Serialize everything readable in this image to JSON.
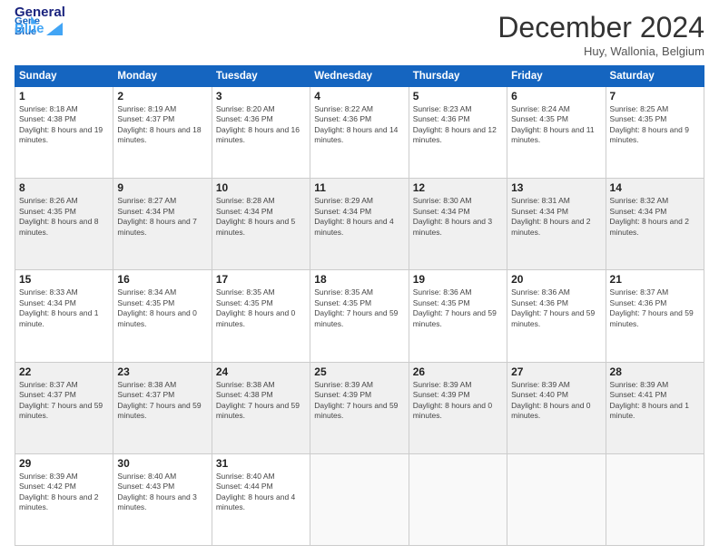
{
  "header": {
    "logo_line1": "General",
    "logo_line2": "Blue",
    "month": "December 2024",
    "location": "Huy, Wallonia, Belgium"
  },
  "days_of_week": [
    "Sunday",
    "Monday",
    "Tuesday",
    "Wednesday",
    "Thursday",
    "Friday",
    "Saturday"
  ],
  "weeks": [
    [
      {
        "day": "1",
        "sunrise": "8:18 AM",
        "sunset": "4:38 PM",
        "daylight": "8 hours and 19 minutes."
      },
      {
        "day": "2",
        "sunrise": "8:19 AM",
        "sunset": "4:37 PM",
        "daylight": "8 hours and 18 minutes."
      },
      {
        "day": "3",
        "sunrise": "8:20 AM",
        "sunset": "4:36 PM",
        "daylight": "8 hours and 16 minutes."
      },
      {
        "day": "4",
        "sunrise": "8:22 AM",
        "sunset": "4:36 PM",
        "daylight": "8 hours and 14 minutes."
      },
      {
        "day": "5",
        "sunrise": "8:23 AM",
        "sunset": "4:36 PM",
        "daylight": "8 hours and 12 minutes."
      },
      {
        "day": "6",
        "sunrise": "8:24 AM",
        "sunset": "4:35 PM",
        "daylight": "8 hours and 11 minutes."
      },
      {
        "day": "7",
        "sunrise": "8:25 AM",
        "sunset": "4:35 PM",
        "daylight": "8 hours and 9 minutes."
      }
    ],
    [
      {
        "day": "8",
        "sunrise": "8:26 AM",
        "sunset": "4:35 PM",
        "daylight": "8 hours and 8 minutes."
      },
      {
        "day": "9",
        "sunrise": "8:27 AM",
        "sunset": "4:34 PM",
        "daylight": "8 hours and 7 minutes."
      },
      {
        "day": "10",
        "sunrise": "8:28 AM",
        "sunset": "4:34 PM",
        "daylight": "8 hours and 5 minutes."
      },
      {
        "day": "11",
        "sunrise": "8:29 AM",
        "sunset": "4:34 PM",
        "daylight": "8 hours and 4 minutes."
      },
      {
        "day": "12",
        "sunrise": "8:30 AM",
        "sunset": "4:34 PM",
        "daylight": "8 hours and 3 minutes."
      },
      {
        "day": "13",
        "sunrise": "8:31 AM",
        "sunset": "4:34 PM",
        "daylight": "8 hours and 2 minutes."
      },
      {
        "day": "14",
        "sunrise": "8:32 AM",
        "sunset": "4:34 PM",
        "daylight": "8 hours and 2 minutes."
      }
    ],
    [
      {
        "day": "15",
        "sunrise": "8:33 AM",
        "sunset": "4:34 PM",
        "daylight": "8 hours and 1 minute."
      },
      {
        "day": "16",
        "sunrise": "8:34 AM",
        "sunset": "4:35 PM",
        "daylight": "8 hours and 0 minutes."
      },
      {
        "day": "17",
        "sunrise": "8:35 AM",
        "sunset": "4:35 PM",
        "daylight": "8 hours and 0 minutes."
      },
      {
        "day": "18",
        "sunrise": "8:35 AM",
        "sunset": "4:35 PM",
        "daylight": "7 hours and 59 minutes."
      },
      {
        "day": "19",
        "sunrise": "8:36 AM",
        "sunset": "4:35 PM",
        "daylight": "7 hours and 59 minutes."
      },
      {
        "day": "20",
        "sunrise": "8:36 AM",
        "sunset": "4:36 PM",
        "daylight": "7 hours and 59 minutes."
      },
      {
        "day": "21",
        "sunrise": "8:37 AM",
        "sunset": "4:36 PM",
        "daylight": "7 hours and 59 minutes."
      }
    ],
    [
      {
        "day": "22",
        "sunrise": "8:37 AM",
        "sunset": "4:37 PM",
        "daylight": "7 hours and 59 minutes."
      },
      {
        "day": "23",
        "sunrise": "8:38 AM",
        "sunset": "4:37 PM",
        "daylight": "7 hours and 59 minutes."
      },
      {
        "day": "24",
        "sunrise": "8:38 AM",
        "sunset": "4:38 PM",
        "daylight": "7 hours and 59 minutes."
      },
      {
        "day": "25",
        "sunrise": "8:39 AM",
        "sunset": "4:39 PM",
        "daylight": "7 hours and 59 minutes."
      },
      {
        "day": "26",
        "sunrise": "8:39 AM",
        "sunset": "4:39 PM",
        "daylight": "8 hours and 0 minutes."
      },
      {
        "day": "27",
        "sunrise": "8:39 AM",
        "sunset": "4:40 PM",
        "daylight": "8 hours and 0 minutes."
      },
      {
        "day": "28",
        "sunrise": "8:39 AM",
        "sunset": "4:41 PM",
        "daylight": "8 hours and 1 minute."
      }
    ],
    [
      {
        "day": "29",
        "sunrise": "8:39 AM",
        "sunset": "4:42 PM",
        "daylight": "8 hours and 2 minutes."
      },
      {
        "day": "30",
        "sunrise": "8:40 AM",
        "sunset": "4:43 PM",
        "daylight": "8 hours and 3 minutes."
      },
      {
        "day": "31",
        "sunrise": "8:40 AM",
        "sunset": "4:44 PM",
        "daylight": "8 hours and 4 minutes."
      },
      null,
      null,
      null,
      null
    ]
  ]
}
